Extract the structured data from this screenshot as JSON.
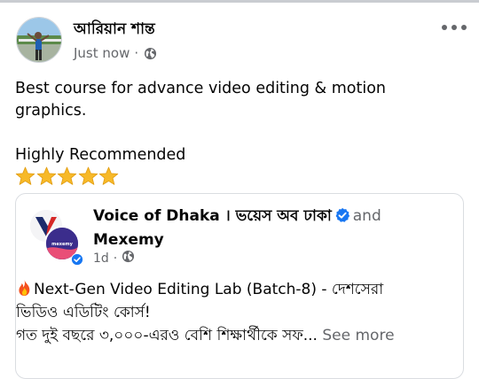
{
  "post": {
    "author_name": "আরিয়ান শান্ত",
    "timestamp": "Just now",
    "separator": "·",
    "privacy_icon": "globe-icon",
    "more_icon": "more-options-icon",
    "text_line1": "Best course for advance video editing & motion",
    "text_line2": "graphics.",
    "text_line3": "Highly Recommended",
    "star_count": 5
  },
  "shared": {
    "page1_name": "Voice of Dhaka । ভয়েস অব ঢাকা",
    "and_word": "and",
    "page2_name": "Mexemy",
    "time": "1d",
    "separator": "·",
    "privacy_icon": "globe-icon",
    "text_line1": "Next-Gen Video Editing Lab (Batch-8) - দেশসেরা",
    "text_line2": "ভিডিও এডিটিং কোর্স!",
    "text_line3": "গত দুই বছরে ৩,০০০-এরও বেশি শিক্ষার্থীকে সফ...",
    "see_more": "See more"
  },
  "colors": {
    "text": "#050505",
    "secondary": "#65676b",
    "verified": "#1877f2",
    "star": "#f7b928"
  }
}
